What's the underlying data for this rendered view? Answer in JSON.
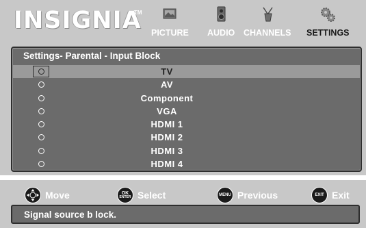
{
  "header": {
    "brand": "INSIGNIA",
    "trademark": "TM",
    "tabs": [
      {
        "label": "PICTURE",
        "icon": "picture-icon",
        "active": false
      },
      {
        "label": "AUDIO",
        "icon": "audio-icon",
        "active": false
      },
      {
        "label": "CHANNELS",
        "icon": "channels-icon",
        "active": false
      },
      {
        "label": "SETTINGS",
        "icon": "settings-icon",
        "active": true
      }
    ]
  },
  "panel": {
    "title": "Settings- Parental - Input Block",
    "items": [
      {
        "label": "TV",
        "selected": true
      },
      {
        "label": "AV",
        "selected": false
      },
      {
        "label": "Component",
        "selected": false
      },
      {
        "label": "VGA",
        "selected": false
      },
      {
        "label": "HDMI 1",
        "selected": false
      },
      {
        "label": "HDMI 2",
        "selected": false
      },
      {
        "label": "HDMI 3",
        "selected": false
      },
      {
        "label": "HDMI 4",
        "selected": false
      }
    ]
  },
  "footer": {
    "move": {
      "label": "Move"
    },
    "select": {
      "label": "Select",
      "key_top": "OK",
      "key_bottom": "ENTER"
    },
    "previous": {
      "label": "Previous",
      "key": "MENU"
    },
    "exit": {
      "label": "Exit",
      "key": "EXIT"
    }
  },
  "status_text": "Signal source b lock.",
  "colors": {
    "background": "#c8c8c8",
    "panel": "#6b6b6b",
    "selected_row": "#9a9a9a",
    "border": "#2e2e2e",
    "text": "#ffffff"
  }
}
